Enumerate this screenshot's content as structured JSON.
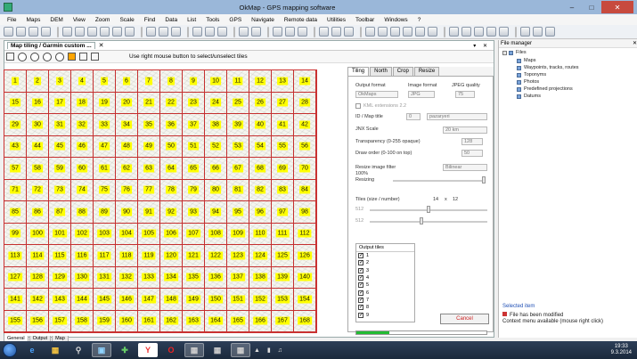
{
  "window": {
    "title": "OkMap - GPS mapping software",
    "minimize": "–",
    "maximize": "□",
    "close": "✕"
  },
  "menu": [
    "File",
    "Maps",
    "DEM",
    "View",
    "Zoom",
    "Scale",
    "Find",
    "Data",
    "List",
    "Tools",
    "GPS",
    "Navigate",
    "Remote data",
    "Utilities",
    "Toolbar",
    "Windows",
    "?"
  ],
  "map_window": {
    "tab_title": "Map tiling / Garmin custom ...",
    "close_glyph": "✕",
    "controls": "▾ ✕",
    "instruction": "Use right mouse button to select/unselect tiles"
  },
  "tiles": {
    "columns": 14,
    "rows": 12,
    "labels": [
      "1",
      "2",
      "3",
      "4",
      "5",
      "6",
      "7",
      "8",
      "9",
      "10",
      "11",
      "12",
      "13",
      "14",
      "15",
      "16",
      "17",
      "18",
      "19",
      "20",
      "21",
      "22",
      "23",
      "24",
      "25",
      "26",
      "27",
      "28",
      "29",
      "30",
      "31",
      "32",
      "33",
      "34",
      "35",
      "36",
      "37",
      "38",
      "39",
      "40",
      "41",
      "42",
      "43",
      "44",
      "45",
      "46",
      "47",
      "48",
      "49",
      "50",
      "51",
      "52",
      "53",
      "54",
      "55",
      "56",
      "57",
      "58",
      "59",
      "60",
      "61",
      "62",
      "63",
      "64",
      "65",
      "66",
      "67",
      "68",
      "69",
      "70",
      "71",
      "72",
      "73",
      "74",
      "75",
      "76",
      "77",
      "78",
      "79",
      "80",
      "81",
      "82",
      "83",
      "84",
      "85",
      "86",
      "87",
      "88",
      "89",
      "90",
      "91",
      "92",
      "93",
      "94",
      "95",
      "96",
      "97",
      "98",
      "99",
      "100",
      "101",
      "102",
      "103",
      "104",
      "105",
      "106",
      "107",
      "108",
      "109",
      "110",
      "111",
      "112",
      "113",
      "114",
      "115",
      "116",
      "117",
      "118",
      "119",
      "120",
      "121",
      "122",
      "123",
      "124",
      "125",
      "126",
      "127",
      "128",
      "129",
      "130",
      "131",
      "132",
      "133",
      "134",
      "135",
      "136",
      "137",
      "138",
      "139",
      "140",
      "141",
      "142",
      "143",
      "144",
      "145",
      "146",
      "147",
      "148",
      "149",
      "150",
      "151",
      "152",
      "153",
      "154",
      "155",
      "156",
      "157",
      "158",
      "159",
      "160",
      "161",
      "162",
      "163",
      "164",
      "165",
      "166",
      "167",
      "168"
    ]
  },
  "panel": {
    "tabs": [
      "Tiling",
      "North",
      "Crop",
      "Resize"
    ],
    "active_tab": "Tiling",
    "output_format_label": "Output format",
    "output_format_value": "OkMaps",
    "image_format_label": "Image format",
    "image_format_value": "JPG",
    "jpeg_quality_label": "JPEG quality",
    "jpeg_quality_value": "75",
    "kml_label": "KML extensions 2.2",
    "id_title_label": "ID / Map title",
    "id_value": "0",
    "map_title_value": "pazaryeri",
    "jnx_scale_label": "JNX Scale",
    "jnx_scale_value": "20 km",
    "transparency_label": "Transparency (0-255 opaque)",
    "transparency_value": "128",
    "draw_order_label": "Draw order (0-100 on top)",
    "draw_order_value": "50",
    "resize_filter_label": "Resize image filter",
    "resize_filter_value": "Bilinear",
    "resize_percent": "100%",
    "resizing_label": "Resizing",
    "tiles_label": "Tiles (size / number)",
    "tiles_x_size": "512",
    "tiles_x_count": "14",
    "tiles_times": "x",
    "tiles_y_count": "12",
    "tiles_y_size": "512",
    "output_tiles_label": "Output tiles",
    "output_tiles": [
      "1",
      "2",
      "3",
      "4",
      "5",
      "6",
      "7",
      "8",
      "9"
    ],
    "cancel_label": "Cancel",
    "progress": 0.25,
    "progress_color": "#22bb33"
  },
  "file_manager": {
    "title": "File manager",
    "root": "Files",
    "items": [
      "Maps",
      "Waypoints, tracks, routes",
      "Toponyms",
      "Photos",
      "Predefined projections",
      "Datums"
    ],
    "selected_label": "Selected item",
    "status_1": "File has been modified",
    "status_2": "Context menu available (mouse right click)"
  },
  "bottom_tabs": [
    "General",
    "Output",
    "Map"
  ],
  "taskbar": {
    "time": "19:33",
    "date": "9.3.2014",
    "apps": [
      "ie-icon",
      "folder-icon",
      "search-icon",
      "okmap-icon",
      "arrows-icon",
      "yandex-icon",
      "opera-icon",
      "app-icon",
      "app2-icon",
      "app3-icon"
    ]
  },
  "colors": {
    "tile_label_bg": "#ffff00",
    "tile_border": "#c53030",
    "cancel_text": "#cc2222"
  }
}
